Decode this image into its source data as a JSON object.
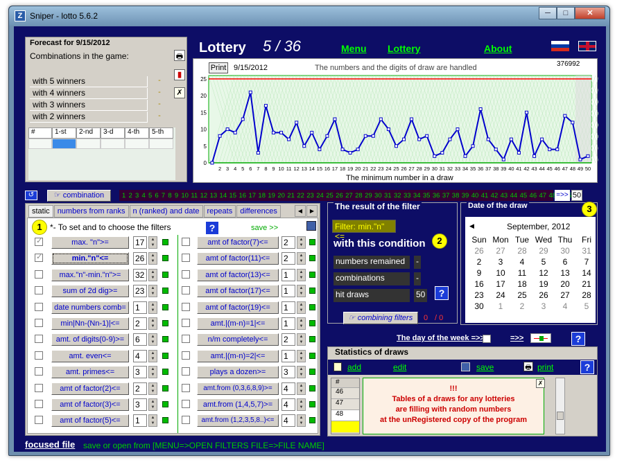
{
  "window": {
    "title": "Sniper - lotto 5.6.2",
    "min": "─",
    "max": "□",
    "close": "✕"
  },
  "forecast": {
    "title": "Forecast for 9/15/2012",
    "subtitle": "Combinations in the game:",
    "rows": [
      {
        "label": "with 5 winners",
        "val": "-"
      },
      {
        "label": "with 4 winners",
        "val": "-"
      },
      {
        "label": "with 3 winners",
        "val": "-"
      },
      {
        "label": "with 2 winners",
        "val": "-"
      }
    ],
    "cols": [
      "#",
      "1-st",
      "2-nd",
      "3-d",
      "4-th",
      "5-th"
    ]
  },
  "header": {
    "title": "Lottery",
    "game": "5 / 36",
    "menu": "Menu",
    "lottery": "Lottery",
    "about": "About"
  },
  "chart_data": {
    "type": "line",
    "print": "Print",
    "date": "9/15/2012",
    "subtitle": "The numbers and the digits of draw are handled",
    "counter": "376992",
    "xlabel": "The minimum number in a draw",
    "ylim": [
      0,
      26
    ],
    "x": [
      1,
      2,
      3,
      4,
      5,
      6,
      7,
      8,
      9,
      10,
      11,
      12,
      13,
      14,
      15,
      16,
      17,
      18,
      19,
      20,
      21,
      22,
      23,
      24,
      25,
      26,
      27,
      28,
      29,
      30,
      31,
      32,
      33,
      34,
      35,
      36,
      37,
      38,
      39,
      40,
      41,
      42,
      43,
      44,
      45,
      46,
      47,
      48,
      49,
      50
    ],
    "yticks": [
      0,
      5,
      10,
      15,
      20,
      25
    ],
    "values": [
      0,
      8,
      10,
      9,
      13,
      21,
      3,
      17,
      9,
      9,
      7,
      12,
      5,
      9,
      4,
      8,
      13,
      4,
      3,
      4,
      8,
      8,
      13,
      10,
      5,
      7,
      13,
      7,
      8,
      2,
      3,
      7,
      10,
      2,
      5,
      16,
      7,
      4,
      1,
      7,
      3,
      15,
      2,
      7,
      4,
      4,
      14,
      12,
      1,
      2
    ]
  },
  "numbers": {
    "list": [
      "1",
      "2",
      "3",
      "4",
      "5",
      "6",
      "7",
      "8",
      "9",
      "10",
      "11",
      "12",
      "13",
      "14",
      "15",
      "16",
      "17",
      "18",
      "19",
      "20",
      "21",
      "22",
      "23",
      "24",
      "25",
      "26",
      "27",
      "28",
      "29",
      "30",
      "31",
      "32",
      "33",
      "34",
      "35",
      "36",
      "37",
      "38",
      "39",
      "40",
      "41",
      "42",
      "43",
      "44",
      "45",
      "46",
      "47",
      "48",
      "49",
      "50"
    ],
    "combination": "combination",
    "arrow": "=>>",
    "count": "50"
  },
  "filters": {
    "tabs": [
      "static",
      "numbers from ranks",
      "n (ranked) and date",
      "repeats",
      "differences"
    ],
    "hint": "*- To set and to choose the filters",
    "save": "save >>",
    "left": [
      {
        "label": "max. \"n\">=",
        "val": "17",
        "chk": true
      },
      {
        "label": "min.\"n\"<=",
        "val": "26",
        "chk": true
      },
      {
        "label": "max.\"n\"-min.\"n\">=",
        "val": "32",
        "chk": false
      },
      {
        "label": "sum of 2d dig>=",
        "val": "23",
        "chk": false
      },
      {
        "label": "date numbers comb=",
        "val": "1",
        "chk": false
      },
      {
        "label": "min|Nn-(Nn-1)|<=",
        "val": "2",
        "chk": false
      },
      {
        "label": "amt. of digits(0-9)>=",
        "val": "6",
        "chk": false
      },
      {
        "label": "amt. even<=",
        "val": "4",
        "chk": false
      },
      {
        "label": "amt. primes<=",
        "val": "3",
        "chk": false
      },
      {
        "label": "amt of factor(2)<=",
        "val": "2",
        "chk": false
      },
      {
        "label": "amt of factor(3)<=",
        "val": "3",
        "chk": false
      },
      {
        "label": "amt of factor(5)<=",
        "val": "1",
        "chk": false
      }
    ],
    "right": [
      {
        "label": "amt of factor(7)<=",
        "val": "2"
      },
      {
        "label": "amt of factor(11)<=",
        "val": "2"
      },
      {
        "label": "amt of factor(13)<=",
        "val": "1"
      },
      {
        "label": "amt of factor(17)<=",
        "val": "1"
      },
      {
        "label": "amt of factor(19)<=",
        "val": "1"
      },
      {
        "label": "amt.|(m-n)=1|<=",
        "val": "1"
      },
      {
        "label": "n/m completely<=",
        "val": "2"
      },
      {
        "label": "amt.|(m-n)=2|<=",
        "val": "1"
      },
      {
        "label": "plays a dozen>=",
        "val": "3"
      },
      {
        "label": "amt.from (0,3,6,8,9)>=",
        "val": "4"
      },
      {
        "label": "amt.from (1,4,5,7)>=",
        "val": "4"
      },
      {
        "label": "amt.from (1,2,3,5,8..)<=",
        "val": "4"
      }
    ]
  },
  "result": {
    "title": "The result of the filter",
    "filter": "Filter: min.\"n\"<=",
    "cond": "with this condition",
    "rows": [
      {
        "label": "numbers remained",
        "val": "-"
      },
      {
        "label": "combinations",
        "val": "-"
      },
      {
        "label": "hit draws",
        "val": "50"
      }
    ],
    "combining": "combining filters",
    "c1": "0",
    "c2": "/ 0"
  },
  "calendar": {
    "title": "Date of the draw",
    "month": "September, 2012",
    "days": [
      "Sun",
      "Mon",
      "Tue",
      "Wed",
      "Thu",
      "Fri"
    ],
    "weeks": [
      [
        "26",
        "27",
        "28",
        "29",
        "30",
        "31"
      ],
      [
        "2",
        "3",
        "4",
        "5",
        "6",
        "7"
      ],
      [
        "9",
        "10",
        "11",
        "12",
        "13",
        "14"
      ],
      [
        "16",
        "17",
        "18",
        "19",
        "20",
        "21"
      ],
      [
        "23",
        "24",
        "25",
        "26",
        "27",
        "28"
      ],
      [
        "30",
        "1",
        "2",
        "3",
        "4",
        "5"
      ]
    ]
  },
  "weekday": {
    "label": "The day of the week =>>",
    "arrow": "=>>"
  },
  "stats": {
    "title": "Statistics of draws",
    "add": "add",
    "edit": "edit",
    "save": "save",
    "print": "print",
    "col": "#",
    "rows": [
      "46",
      "47",
      "48"
    ],
    "msg1": "!!!",
    "msg2": "Tables of a draws for any lotteries",
    "msg3": "are filling with random numbers",
    "msg4": "at the unRegistered copy of the program"
  },
  "footer": {
    "focused": "focused file",
    "hint": "save or open from [MENU=>OPEN FILTERS FILE=>FILE NAME]"
  },
  "colors": {
    "bg": "#0d0d66",
    "line": "#0000cc",
    "green": "#00cc00",
    "red": "#ff0000"
  }
}
